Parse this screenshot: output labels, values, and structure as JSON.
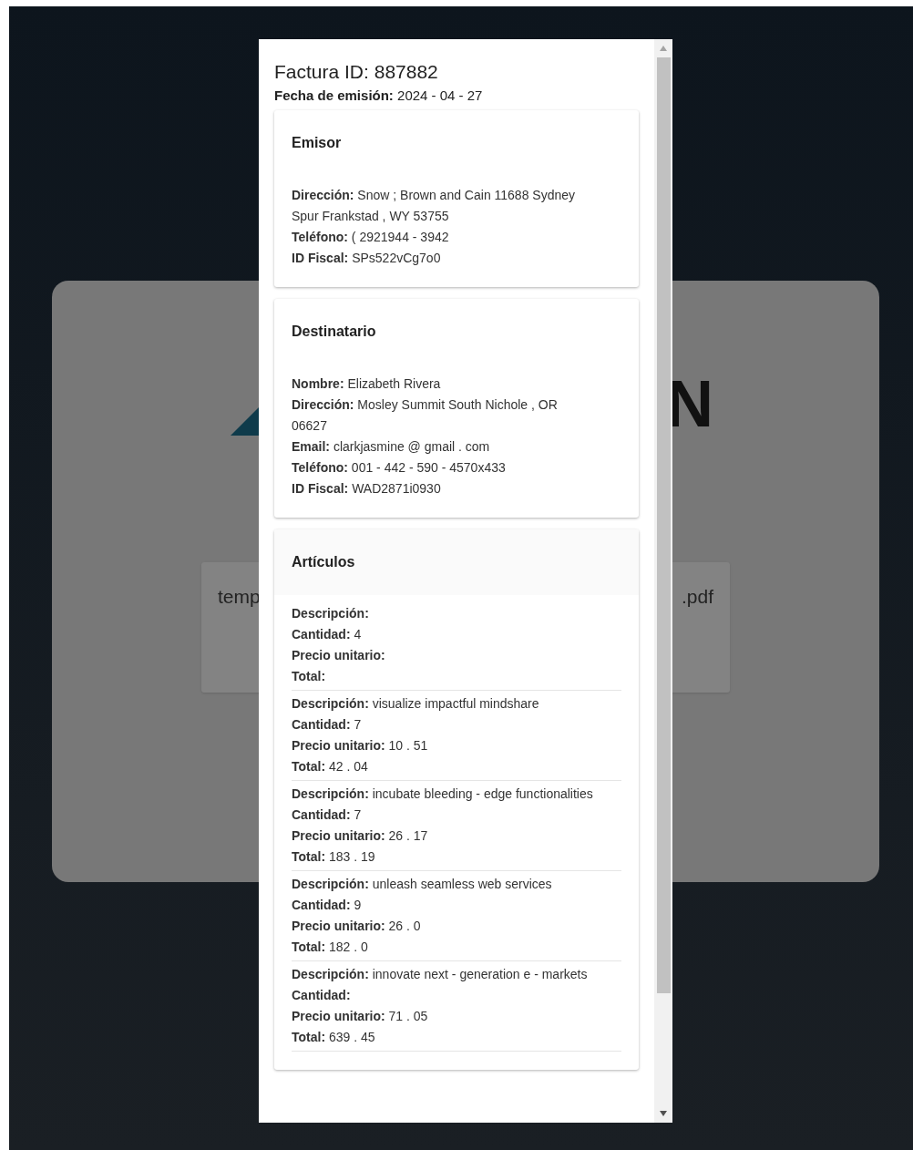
{
  "background": {
    "logo_text": "N",
    "file_card": {
      "name_start": "temp",
      "name_end": ".pdf"
    }
  },
  "invoice": {
    "title": "Factura ID: 887882",
    "date": {
      "label": "Fecha de emisión:",
      "value": "2024 - 04 - 27"
    },
    "sections": [
      {
        "title": "Emisor",
        "fields": [
          {
            "label": "Dirección:",
            "value": "Snow ; Brown and Cain 11688 Sydney Spur Frankstad , WY 53755"
          },
          {
            "label": "Teléfono:",
            "value": "( 2921944 - 3942"
          },
          {
            "label": "ID Fiscal:",
            "value": "SPs522vCg7o0"
          }
        ]
      },
      {
        "title": "Destinatario",
        "fields": [
          {
            "label": "Nombre:",
            "value": "Elizabeth Rivera"
          },
          {
            "label": "Dirección:",
            "value": "Mosley Summit South Nichole , OR 06627"
          },
          {
            "label": "Email:",
            "value": "clarkjasmine @ gmail . com"
          },
          {
            "label": "Teléfono:",
            "value": "001 - 442 - 590 - 4570x433"
          },
          {
            "label": "ID Fiscal:",
            "value": "WAD2871i0930"
          }
        ]
      }
    ],
    "items_section": {
      "title": "Artículos",
      "items": [
        [
          {
            "label": "Descripción:"
          },
          {
            "label": "Cantidad:",
            "value": "4"
          },
          {
            "label": "Precio unitario:"
          },
          {
            "label": "Total:"
          }
        ],
        [
          {
            "label": "Descripción:",
            "value": "visualize impactful mindshare"
          },
          {
            "label": "Cantidad:",
            "value": "7"
          },
          {
            "label": "Precio unitario:",
            "value": "10 . 51"
          },
          {
            "label": "Total:",
            "value": "42 . 04"
          }
        ],
        [
          {
            "label": "Descripción:",
            "value": "incubate bleeding - edge functionalities"
          },
          {
            "label": "Cantidad:",
            "value": "7"
          },
          {
            "label": "Precio unitario:",
            "value": "26 . 17"
          },
          {
            "label": "Total:",
            "value": "183 . 19"
          }
        ],
        [
          {
            "label": "Descripción:",
            "value": "unleash seamless web services"
          },
          {
            "label": "Cantidad:",
            "value": "9"
          },
          {
            "label": "Precio unitario:",
            "value": "26 . 0"
          },
          {
            "label": "Total:",
            "value": "182 . 0"
          }
        ],
        [
          {
            "label": "Descripción:",
            "value": "innovate next - generation e - markets"
          },
          {
            "label": "Cantidad:"
          },
          {
            "label": "Precio unitario:",
            "value": "71 . 05"
          },
          {
            "label": "Total:",
            "value": "639 . 45"
          }
        ]
      ]
    }
  }
}
